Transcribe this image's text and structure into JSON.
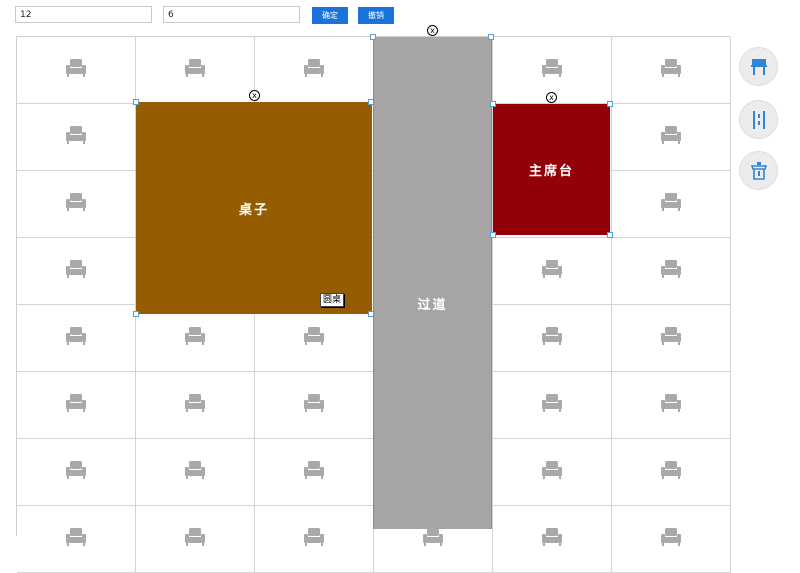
{
  "toolbar": {
    "rows_value": "12",
    "cols_value": "6",
    "confirm_label": "确定",
    "cancel_label": "撤销"
  },
  "areas": {
    "table_label": "桌子",
    "table_shape_tag": "圆桌",
    "aisle_label": "过道",
    "stage_label": "主席台",
    "close_symbol": "x"
  },
  "colors": {
    "table": "#955c00",
    "aisle": "#a7a4a5",
    "stage": "#940008",
    "chair": "#a9a9a9",
    "accent": "#1a73d9"
  },
  "tools": [
    {
      "icon": "table-icon"
    },
    {
      "icon": "aisle-icon"
    },
    {
      "icon": "podium-icon"
    }
  ]
}
